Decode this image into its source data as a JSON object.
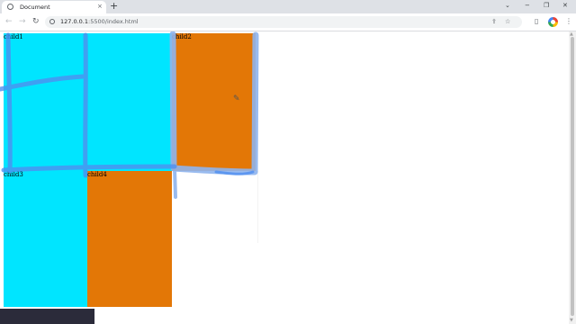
{
  "browser": {
    "tab_title": "Document",
    "tab_close": "×",
    "new_tab": "+",
    "url_host": "127.0.0.1",
    "url_path": ":5500/index.html",
    "controls": {
      "dropdown": "⌄",
      "minimize": "−",
      "restore": "❐",
      "close": "✕"
    },
    "nav": {
      "back": "←",
      "forward": "→",
      "reload": "↻"
    },
    "icons": [
      "info-icon",
      "share-icon",
      "bookmark-star-icon",
      "sidebar-icon",
      "profile-avatar",
      "menu-icon"
    ]
  },
  "page": {
    "boxes": [
      {
        "label": "child1",
        "color": "#00e5ff"
      },
      {
        "label": "child2",
        "color": "#e37706"
      },
      {
        "label": "child3",
        "color": "#00e5ff"
      },
      {
        "label": "child4",
        "color": "#e37706"
      }
    ]
  },
  "annotation": {
    "pen_color": "#4f8ff0",
    "pen_shadow": "#8fb4ee"
  },
  "icon_glyphs": {
    "share": "⇪",
    "star": "☆",
    "sidebar": "▯",
    "menu": "⋮",
    "pen": "✎"
  }
}
